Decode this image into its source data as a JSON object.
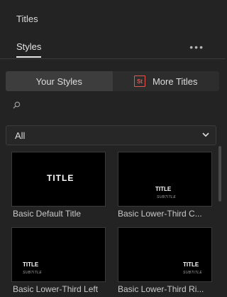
{
  "panel": {
    "title": "Titles"
  },
  "tabs": {
    "styles_label": "Styles",
    "more_label": "•••"
  },
  "segmented": {
    "your_styles": "Your Styles",
    "more_titles": "More Titles",
    "st_badge": "St"
  },
  "search": {
    "placeholder": ""
  },
  "filter": {
    "value": "All"
  },
  "thumbnails": [
    {
      "title": "TITLE",
      "subtitle": "",
      "caption": "Basic Default Title"
    },
    {
      "title": "TITLE",
      "subtitle": "SUBTITLE",
      "caption": "Basic Lower-Third C..."
    },
    {
      "title": "TITLE",
      "subtitle": "SUBTITLE",
      "caption": "Basic Lower-Third Left"
    },
    {
      "title": "TITLE",
      "subtitle": "SUBTITLE",
      "caption": "Basic Lower-Third Ri..."
    }
  ],
  "colors": {
    "background": "#232323",
    "accent_st": "#e0574e"
  }
}
